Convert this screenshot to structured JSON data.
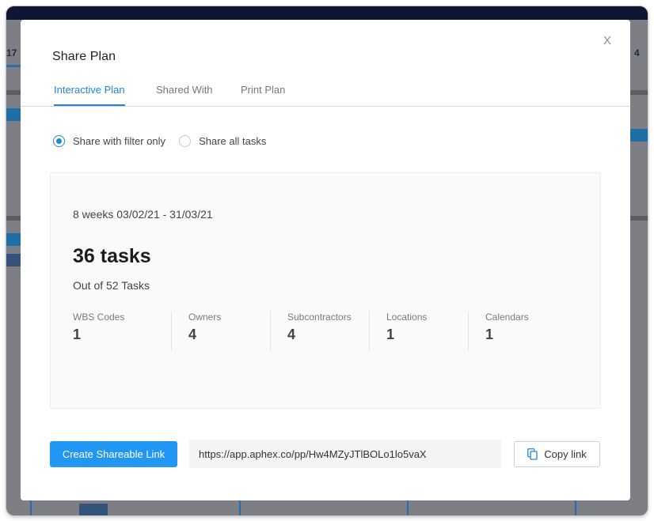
{
  "background": {
    "left_number": "17",
    "right_number": "4"
  },
  "modal": {
    "title": "Share Plan",
    "close_label": "X",
    "tabs": [
      {
        "label": "Interactive Plan",
        "active": true
      },
      {
        "label": "Shared With",
        "active": false
      },
      {
        "label": "Print Plan",
        "active": false
      }
    ],
    "share_options": [
      {
        "label": "Share with filter only",
        "selected": true
      },
      {
        "label": "Share all tasks",
        "selected": false
      }
    ],
    "summary": {
      "date_range": "8 weeks 03/02/21 - 31/03/21",
      "task_count": "36 tasks",
      "out_of": "Out of 52 Tasks",
      "stats": [
        {
          "label": "WBS Codes",
          "value": "1"
        },
        {
          "label": "Owners",
          "value": "4"
        },
        {
          "label": "Subcontractors",
          "value": "4"
        },
        {
          "label": "Locations",
          "value": "1"
        },
        {
          "label": "Calendars",
          "value": "1"
        }
      ]
    },
    "create_link_label": "Create Shareable Link",
    "share_url": "https://app.aphex.co/pp/Hw4MZyJTlBOLo1lo5vaX",
    "copy_link_label": "Copy link",
    "copy_icon": "copy-icon"
  },
  "colors": {
    "accent": "#2196f3",
    "tab_active": "#1f86d2",
    "top_bar": "#0f1633",
    "overlay": "#7d7f84"
  }
}
